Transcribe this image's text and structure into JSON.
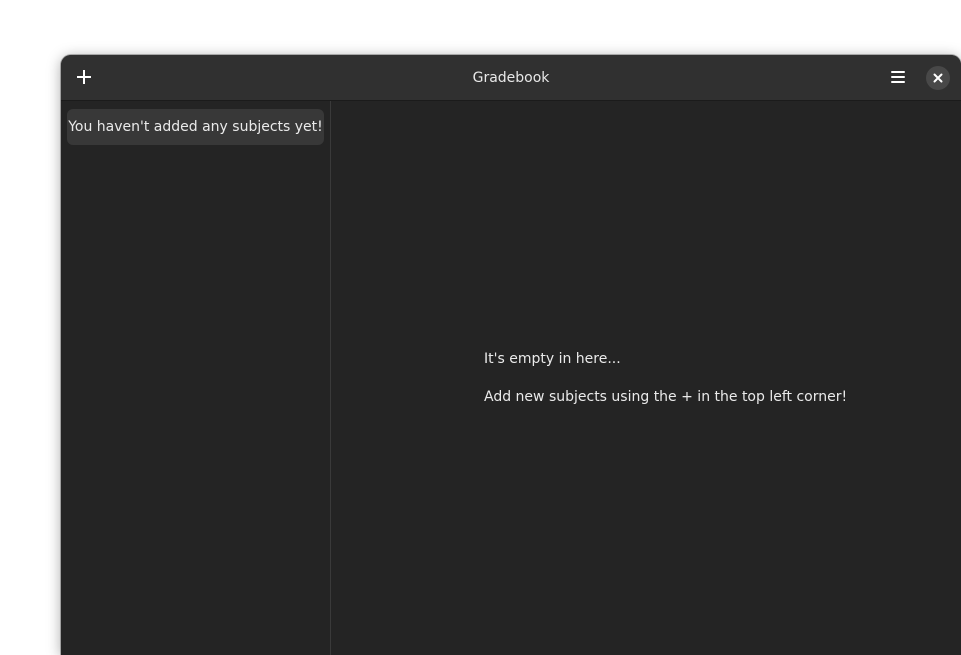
{
  "window": {
    "title": "Gradebook"
  },
  "headerbar": {
    "add_icon": "plus-icon",
    "menu_icon": "hamburger-menu-icon",
    "close_icon": "close-icon"
  },
  "sidebar": {
    "empty_message": "You haven't added any subjects yet!"
  },
  "content": {
    "empty_title": "It's empty in here...",
    "empty_hint": "Add new subjects using the + in the top left corner!"
  },
  "colors": {
    "window_bg": "#242424",
    "headerbar_bg": "#303030",
    "sidebar_row_bg": "#383838",
    "text": "#eaeaea"
  }
}
